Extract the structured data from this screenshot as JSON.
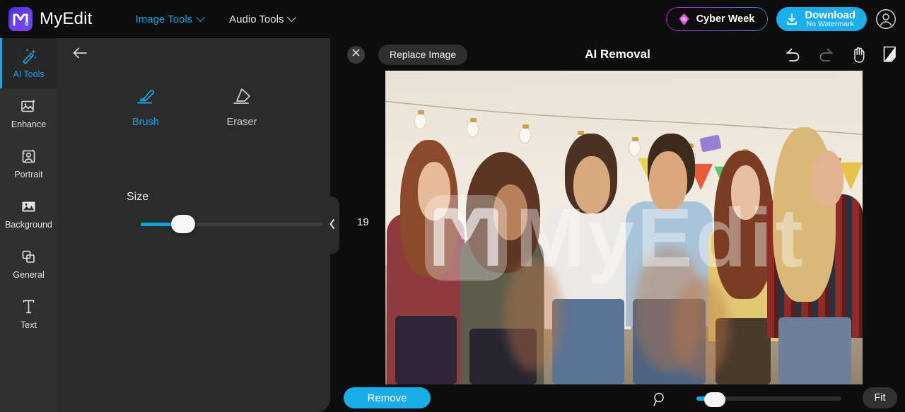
{
  "brand": {
    "name": "MyEdit",
    "logo_icon": "myedit-logo-icon",
    "accent": "#17a7e8",
    "logo_bg": "#6f3ff0"
  },
  "topnav": {
    "items": [
      {
        "label": "Image Tools",
        "icon": "chevron-down-icon",
        "active": true
      },
      {
        "label": "Audio Tools",
        "icon": "chevron-down-icon",
        "active": false
      }
    ],
    "promo": {
      "label": "Cyber Week",
      "icon": "discount-tag-icon"
    },
    "download": {
      "main": "Download",
      "sub": "No Watermark",
      "icon": "download-icon"
    },
    "account": {
      "icon": "user-account-icon"
    }
  },
  "sidebar": {
    "items": [
      {
        "label": "AI Tools",
        "icon": "magic-wand-icon",
        "active": true
      },
      {
        "label": "Enhance",
        "icon": "image-sparkle-icon",
        "active": false
      },
      {
        "label": "Portrait",
        "icon": "portrait-person-icon",
        "active": false
      },
      {
        "label": "Background",
        "icon": "background-image-icon",
        "active": false
      },
      {
        "label": "General",
        "icon": "layers-copy-icon",
        "active": false
      },
      {
        "label": "Text",
        "icon": "text-t-icon",
        "active": false
      }
    ]
  },
  "panel": {
    "back_icon": "back-arrow-icon",
    "tools": [
      {
        "label": "Brush",
        "icon": "brush-icon",
        "active": true
      },
      {
        "label": "Eraser",
        "icon": "eraser-icon",
        "active": false
      }
    ],
    "size": {
      "label": "Size",
      "value": "19",
      "percent": 19,
      "min": 0,
      "max": 100
    },
    "collapse_icon": "chevron-left-icon"
  },
  "canvas": {
    "close_icon": "close-x-icon",
    "replace_label": "Replace Image",
    "title": "AI Removal",
    "actions": [
      {
        "icon": "undo-icon",
        "enabled": true
      },
      {
        "icon": "redo-icon",
        "enabled": false
      },
      {
        "icon": "hand-pan-icon",
        "enabled": true
      },
      {
        "icon": "compare-split-icon",
        "enabled": true
      }
    ],
    "watermark": "MyEdit"
  },
  "bottombar": {
    "remove_label": "Remove",
    "zoom_icon": "magnifier-icon",
    "zoom": {
      "percent": 6
    },
    "fit_label": "Fit"
  }
}
